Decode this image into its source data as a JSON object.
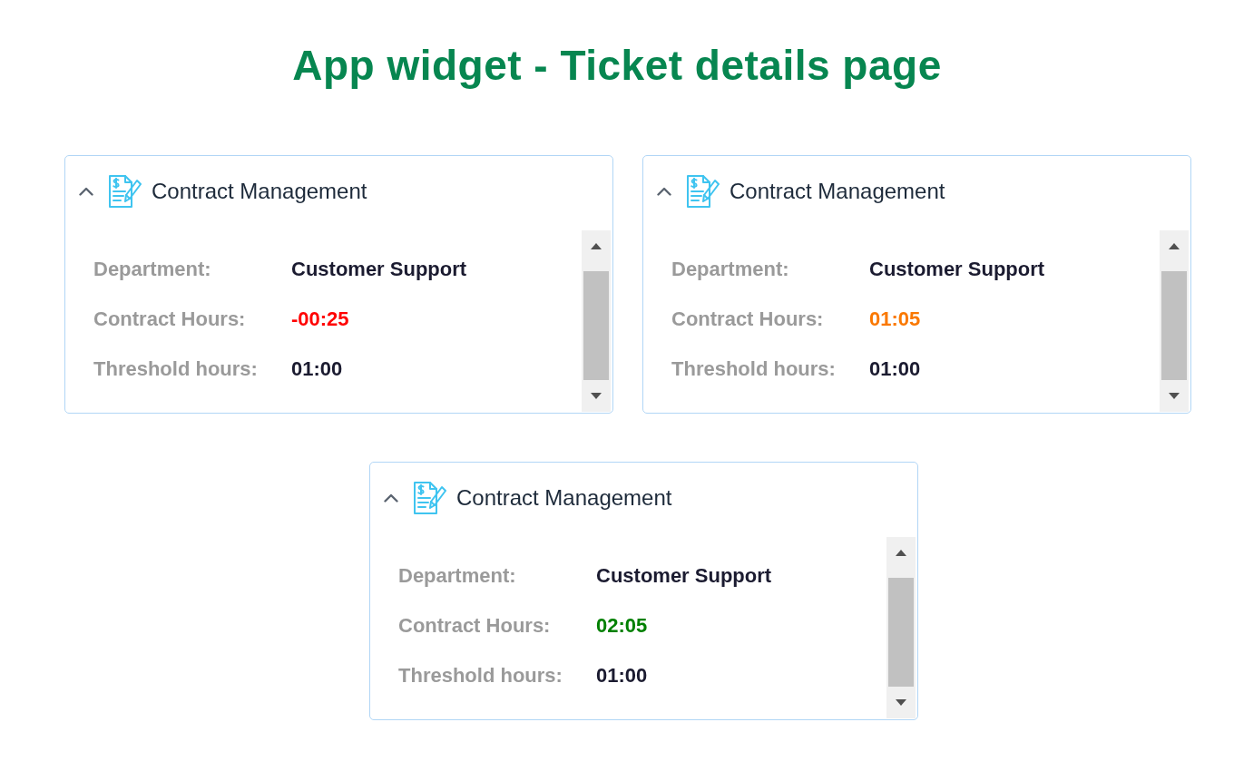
{
  "title": "App widget - Ticket details page",
  "widgets": [
    {
      "title": "Contract Management",
      "expanded": true,
      "fields": [
        {
          "label": "Department:",
          "value": "Customer Support"
        },
        {
          "label": "Contract Hours:",
          "value": "-00:25",
          "color": "#ff0000"
        },
        {
          "label": "Threshold hours:",
          "value": "01:00"
        }
      ]
    },
    {
      "title": "Contract Management",
      "expanded": true,
      "fields": [
        {
          "label": "Department:",
          "value": "Customer Support"
        },
        {
          "label": "Contract Hours:",
          "value": "01:05",
          "color": "#fa7800"
        },
        {
          "label": "Threshold hours:",
          "value": "01:00"
        }
      ]
    },
    {
      "title": "Contract Management",
      "expanded": true,
      "fields": [
        {
          "label": "Department:",
          "value": "Customer Support"
        },
        {
          "label": "Contract Hours:",
          "value": "02:05",
          "color": "#008000"
        },
        {
          "label": "Threshold hours:",
          "value": "01:00"
        }
      ]
    }
  ]
}
